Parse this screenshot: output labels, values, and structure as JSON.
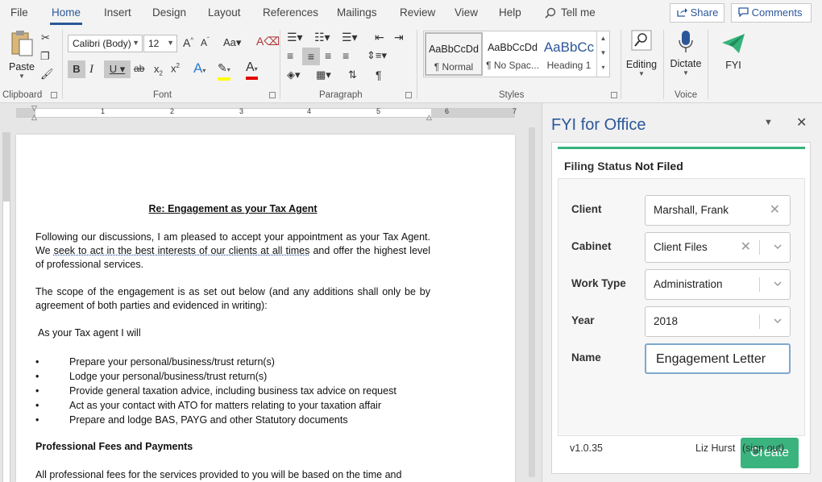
{
  "tabs": [
    "File",
    "Home",
    "Insert",
    "Design",
    "Layout",
    "References",
    "Mailings",
    "Review",
    "View",
    "Help"
  ],
  "active_tab": "Home",
  "tell_me": "Tell me",
  "share_label": "Share",
  "comments_label": "Comments",
  "ribbon": {
    "paste_label": "Paste",
    "font_name": "Calibri (Body)",
    "font_size": "12",
    "styles": [
      {
        "preview": "AaBbCcDd",
        "name": "¶ Normal"
      },
      {
        "preview": "AaBbCcDd",
        "name": "¶ No Spac..."
      },
      {
        "preview": "AaBbCc",
        "name": "Heading 1"
      }
    ],
    "editing_label": "Editing",
    "dictate_label": "Dictate",
    "fyi_label": "FYI",
    "groups": {
      "clipboard": "Clipboard",
      "font": "Font",
      "paragraph": "Paragraph",
      "styles": "Styles",
      "voice": "Voice"
    },
    "colors": {
      "accent": "#2b579a",
      "highlight": "#ffff00",
      "font_color": "#e00000"
    }
  },
  "ruler_numbers": [
    "1",
    "2",
    "3",
    "4",
    "5",
    "6",
    "7"
  ],
  "document": {
    "heading": "Re: Engagement as your Tax Agent",
    "para1_start": "Following our discussions, I am pleased to accept your appointment as your Tax Agent.  We ",
    "para1_underlined": "seek to act in the best interests of our clients at all times",
    "para1_end": " and offer the highest level of professional services.",
    "para2": "The scope of the engagement is as set out below (and any additions shall only be by agreement of both parties and evidenced in writing):",
    "intro": "As your Tax agent I will",
    "bullets": [
      "Prepare your personal/business/trust return(s)",
      "Lodge your personal/business/trust return(s)",
      "Provide general taxation advice, including business tax advice on request",
      "Act as your contact with ATO for matters relating to your taxation affair",
      "Prepare and lodge BAS, PAYG and other Statutory documents"
    ],
    "section_heading": "Professional Fees and Payments",
    "cut_line": "All professional fees for the services provided to you will be based on the time and"
  },
  "pane": {
    "title": "FYI for Office",
    "filing_label": "Filing Status",
    "filing_value": "Not Filed",
    "fields": [
      {
        "label": "Client",
        "value": "Marshall, Frank"
      },
      {
        "label": "Cabinet",
        "value": "Client Files"
      },
      {
        "label": "Work Type",
        "value": "Administration"
      },
      {
        "label": "Year",
        "value": "2018"
      },
      {
        "label": "Name",
        "value": "Engagement Letter"
      }
    ],
    "create_label": "Create",
    "version": "v1.0.35",
    "user": "Liz Hurst",
    "sign_out": "(sign out)",
    "colors": {
      "title": "#2b579a",
      "status_bar": "#35b27a",
      "create_button": "#3ab37e"
    }
  }
}
